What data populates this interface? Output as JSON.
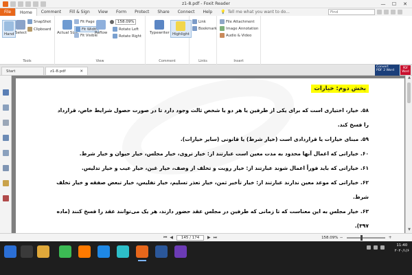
{
  "window": {
    "title": "z1-8.pdf - Foxit Reader",
    "minimize": "—",
    "maximize": "☐",
    "close": "✕"
  },
  "ribbon_tabs": [
    "File",
    "Home",
    "Comment",
    "Fill & Sign",
    "View",
    "Form",
    "Protect",
    "Share",
    "Connect",
    "Help"
  ],
  "active_tab": "Home",
  "tell_me": "Tell me what you want to do...",
  "find_placeholder": "Find",
  "tools_group": {
    "label": "Tools",
    "hand": "Hand",
    "select": "Select",
    "snapshot": "SnapShot",
    "clipboard": "Clipboard"
  },
  "view_group": {
    "label": "View",
    "actual_size": "Actual Size",
    "fit_page": "Fit Page",
    "fit_width": "Fit Width",
    "fit_visible": "Fit Visible",
    "reflow": "Reflow",
    "zoom": "158.09%",
    "rotate_left": "Rotate Left",
    "rotate_right": "Rotate Right"
  },
  "comment_group": {
    "label": "Comment",
    "typewriter": "Typewriter",
    "highlight": "Highlight"
  },
  "links_group": {
    "label": "Links",
    "link": "Link",
    "bookmark": "Bookmark"
  },
  "insert_group": {
    "label": "Insert",
    "file_attachment": "File Attachment",
    "image_annotation": "Image Annotation",
    "audio_video": "Audio & Video"
  },
  "doc_tabs": [
    {
      "label": "Start",
      "close": ""
    },
    {
      "label": "z1-8.pdf",
      "close": "✕"
    }
  ],
  "convert_banner": {
    "line1": "Convert",
    "line2": "PDF 2 Word",
    "badge_top": "PDF",
    "badge_bottom": "Word"
  },
  "document": {
    "heading": "بخش دوم: خیارات",
    "paragraphs": [
      "۵۸. خیار، اختیاری است که برای یکی از طرفین یا هر دو یا شخص ثالث وجود دارد تا در صورت حصول شرایط خاص، قرارداد را فسخ کند.",
      "۵۹. مبنای خیارات یا قراردادی است (خیار شرط) یا قانونی (سایر خیارات).",
      "۶۰. خیاراتی که اعمال آنها محدود به مدت معین است عبارتند از: خیار تروی، خیار مجلس، خیار حیوان و خیار شرط.",
      "۶۱. خیاراتی که باید فوراً اعمال شوند عبارتند از: خیار رویت و تخلف از وصف، خیار غبن، خیار عیب و خیار تدلیس.",
      "۶۲. خیاراتی که موعد معین ندارند عبارتند از: خیار تأخیر ثمن، خیار تعذر تسلیم، خیار تفلیس، خیار تبعض صفقه و خیار تخلف شرط.",
      "۶۳. خیار مجلس به این معناست که تا زمانی که طرفین در مجلس عقد حضور دارند، هر یک می‌توانند عقد را فسخ کنند (ماده ۳۹۷)."
    ]
  },
  "statusbar": {
    "first": "⏮",
    "prev": "◀",
    "page": "145 / 174",
    "next": "▶",
    "last": "⏭",
    "zoom": "158.09%",
    "zoom_minus": "−",
    "zoom_plus": "+"
  },
  "taskbar": {
    "time": "11:40",
    "date": "۲۰۲۰/۱/۶",
    "lang": "ENG"
  },
  "colors": {
    "accent": "#e8671b",
    "highlight": "#ffff00",
    "doc_bg": "#7f7f7f"
  }
}
